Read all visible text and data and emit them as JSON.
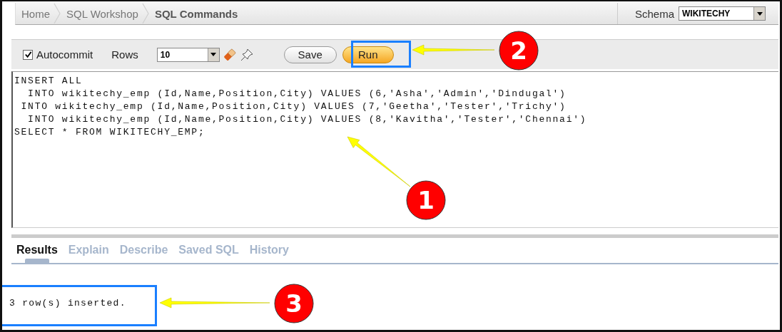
{
  "breadcrumb": [
    {
      "label": "Home",
      "current": false
    },
    {
      "label": "SQL Workshop",
      "current": false
    },
    {
      "label": "SQL Commands",
      "current": true
    }
  ],
  "schema": {
    "label": "Schema",
    "value": "WIKITECHY"
  },
  "toolbar": {
    "autocommit": {
      "label": "Autocommit",
      "checked": true
    },
    "rows": {
      "label": "Rows",
      "value": "10"
    },
    "buttons": [
      {
        "label": "Save",
        "kind": "plain"
      },
      {
        "label": "Run",
        "kind": "primary"
      }
    ]
  },
  "editor": {
    "lines": [
      "INSERT ALL",
      "  INTO wikitechy_emp (Id,Name,Position,City) VALUES (6,'Asha','Admin','Dindugal')",
      " INTO wikitechy_emp (Id,Name,Position,City) VALUES (7,'Geetha','Tester','Trichy')",
      "  INTO wikitechy_emp (Id,Name,Position,City) VALUES (8,'Kavitha','Tester','Chennai')",
      "SELECT * FROM WIKITECHY_EMP;"
    ]
  },
  "tabs": [
    {
      "label": "Results",
      "selected": true
    },
    {
      "label": "Explain",
      "selected": false
    },
    {
      "label": "Describe",
      "selected": false
    },
    {
      "label": "Saved SQL",
      "selected": false
    },
    {
      "label": "History",
      "selected": false
    }
  ],
  "result": {
    "message": "3 row(s) inserted."
  },
  "callouts": [
    {
      "number": "1"
    },
    {
      "number": "2"
    },
    {
      "number": "3"
    }
  ]
}
